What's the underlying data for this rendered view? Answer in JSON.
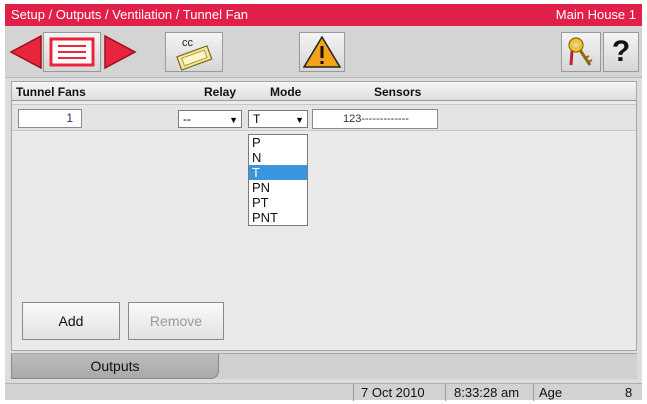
{
  "titlebar": {
    "breadcrumb": "Setup / Outputs / Ventilation / Tunnel Fan",
    "house": "Main House 1",
    "color": "#e02048"
  },
  "toolbar": {
    "icons": [
      "arrow-left-icon",
      "list-panel-icon",
      "arrow-right-icon",
      "cc-copy-icon",
      "warning-icon",
      "keys-icon",
      "help-icon"
    ],
    "copy_label": "cc",
    "help_label": "?",
    "accent": "#e8253c"
  },
  "table": {
    "headers": {
      "name": "Tunnel Fans",
      "relay": "Relay",
      "mode": "Mode",
      "sensors": "Sensors"
    },
    "row": {
      "number": "1",
      "relay": "--",
      "mode": "T",
      "sensors": "123-------------"
    }
  },
  "mode_dropdown": {
    "options": [
      "P",
      "N",
      "T",
      "PN",
      "PT",
      "PNT"
    ],
    "selected": "T",
    "highlight_color": "#3a97de"
  },
  "buttons": {
    "add": "Add",
    "remove": "Remove"
  },
  "tabs": {
    "outputs": "Outputs"
  },
  "status": {
    "date": "7 Oct 2010",
    "time": "8:33:28 am",
    "age_label": "Age",
    "age_value": "8"
  }
}
